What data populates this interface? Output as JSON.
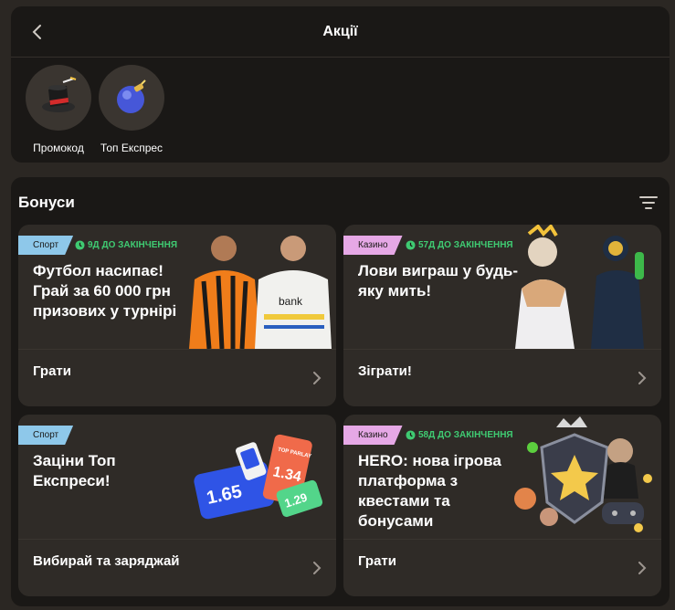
{
  "header": {
    "title": "Акції"
  },
  "promos": [
    {
      "label": "Промокод",
      "icon": "magic-hat-icon"
    },
    {
      "label": "Топ Експрес",
      "icon": "blue-bomb-icon"
    }
  ],
  "bonuses": {
    "title": "Бонуси",
    "cards": [
      {
        "tag": "Спорт",
        "timer": "9Д ДО ЗАКІНЧЕННЯ",
        "title": "Футбол насипає! Грай за 60 000 грн призових у турнірі",
        "action": "Грати"
      },
      {
        "tag": "Казино",
        "timer": "57Д ДО ЗАКІНЧЕННЯ",
        "title": "Лови виграш у будь-яку мить!",
        "action": "Зіграти!"
      },
      {
        "tag": "Спорт",
        "timer": "",
        "title": "Заціни Топ Експреси!",
        "action": "Вибирай та заряджай",
        "art": {
          "ticket1": "1.65",
          "ticket2": "1.34",
          "ticket3": "1.29",
          "ticket_label": "TOP PARLAY"
        }
      },
      {
        "tag": "Казино",
        "timer": "58Д ДО ЗАКІНЧЕННЯ",
        "title": "HERO: нова ігрова платформа з квестами та бонусами",
        "action": "Грати"
      }
    ]
  },
  "colors": {
    "sport": "#8ec8ea",
    "casino": "#e6a8e6",
    "timer": "#3fcb72"
  }
}
